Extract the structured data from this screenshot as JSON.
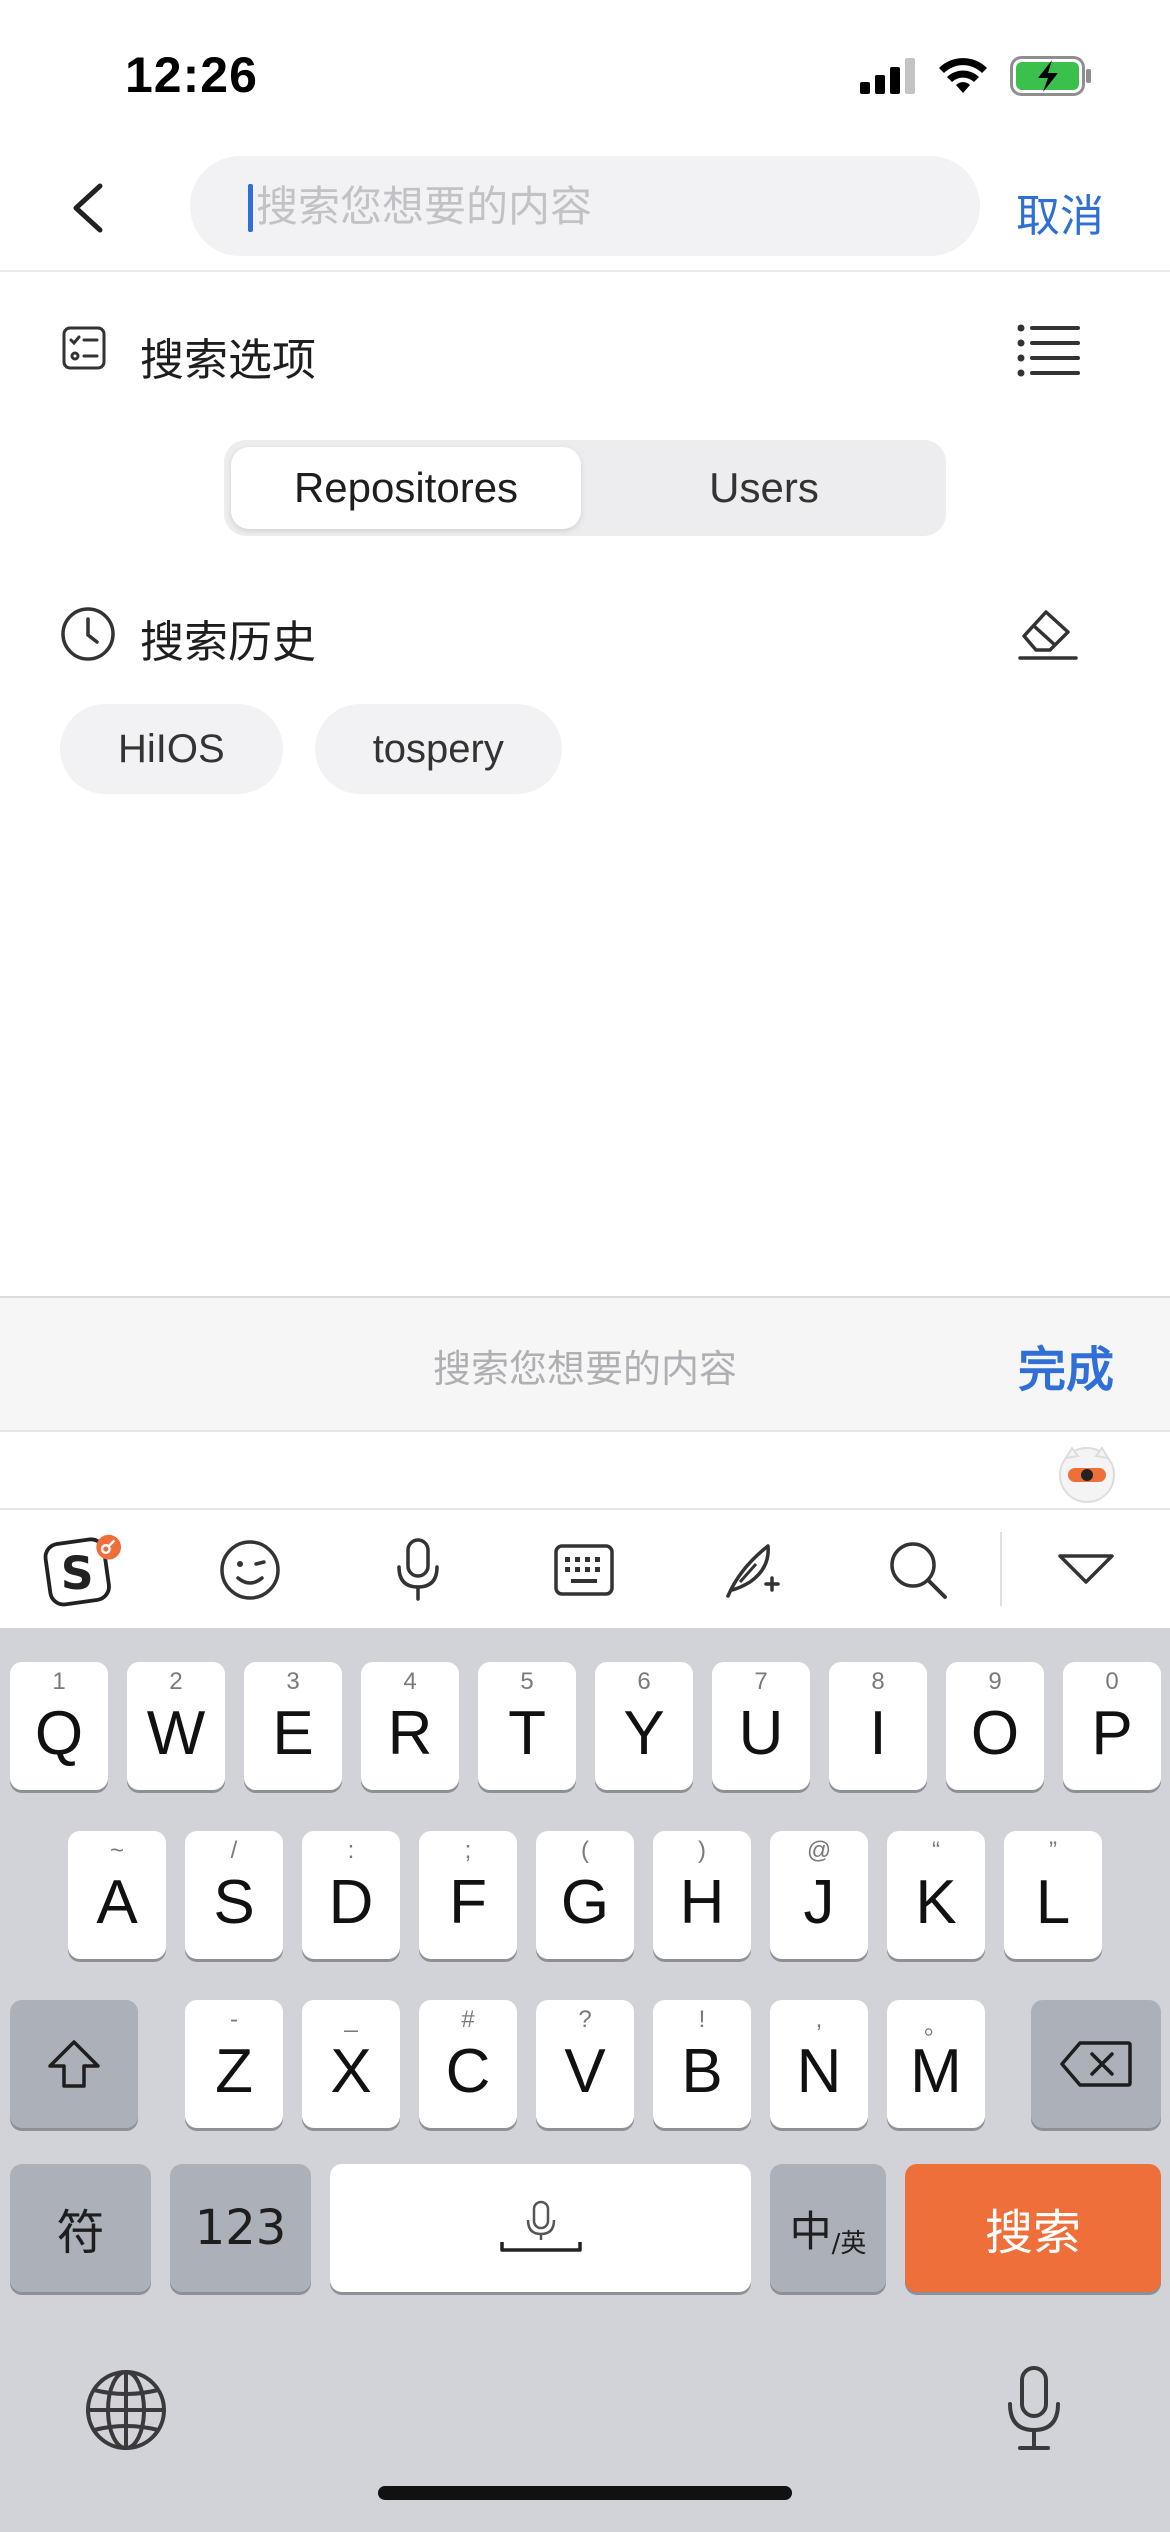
{
  "status_bar": {
    "time": "12:26"
  },
  "header": {
    "search_placeholder": "搜索您想要的内容",
    "cancel_label": "取消"
  },
  "search_options": {
    "title": "搜索选项"
  },
  "segmented": {
    "options": [
      "Repositores",
      "Users"
    ],
    "selected": "Repositores"
  },
  "history": {
    "title": "搜索历史",
    "items": [
      "HiIOS",
      "tospery"
    ]
  },
  "accessory": {
    "placeholder": "搜索您想要的内容",
    "done_label": "完成"
  },
  "keyboard": {
    "row1": [
      {
        "letter": "Q",
        "hint": "1"
      },
      {
        "letter": "W",
        "hint": "2"
      },
      {
        "letter": "E",
        "hint": "3"
      },
      {
        "letter": "R",
        "hint": "4"
      },
      {
        "letter": "T",
        "hint": "5"
      },
      {
        "letter": "Y",
        "hint": "6"
      },
      {
        "letter": "U",
        "hint": "7"
      },
      {
        "letter": "I",
        "hint": "8"
      },
      {
        "letter": "O",
        "hint": "9"
      },
      {
        "letter": "P",
        "hint": "0"
      }
    ],
    "row2": [
      {
        "letter": "A",
        "hint": "~"
      },
      {
        "letter": "S",
        "hint": "/"
      },
      {
        "letter": "D",
        "hint": ":"
      },
      {
        "letter": "F",
        "hint": ";"
      },
      {
        "letter": "G",
        "hint": "("
      },
      {
        "letter": "H",
        "hint": ")"
      },
      {
        "letter": "J",
        "hint": "@"
      },
      {
        "letter": "K",
        "hint": "“"
      },
      {
        "letter": "L",
        "hint": "”"
      }
    ],
    "row3": [
      {
        "letter": "Z",
        "hint": "-"
      },
      {
        "letter": "X",
        "hint": "_"
      },
      {
        "letter": "C",
        "hint": "#"
      },
      {
        "letter": "V",
        "hint": "?"
      },
      {
        "letter": "B",
        "hint": "!"
      },
      {
        "letter": "N",
        "hint": ","
      },
      {
        "letter": "M",
        "hint": "。"
      }
    ],
    "symbols_label": "符",
    "numbers_label": "123",
    "lang_main": "中",
    "lang_sub": "/英",
    "search_label": "搜索"
  },
  "colors": {
    "accent": "#2f6fd6",
    "search_key": "#ee6f3a",
    "keyboard_bg": "#d1d3d9"
  }
}
